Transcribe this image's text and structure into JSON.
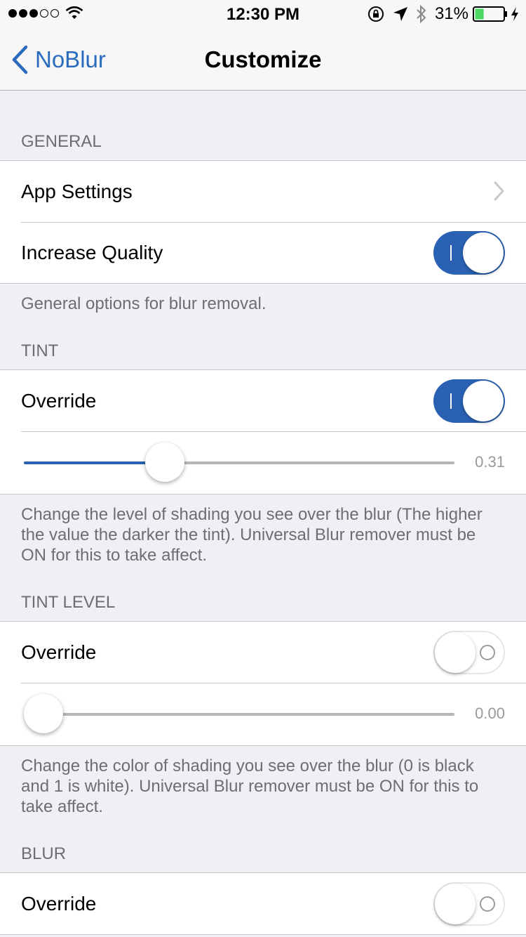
{
  "status_bar": {
    "time": "12:30 PM",
    "battery_percent": "31%",
    "battery_level": 0.31,
    "signal_bars_filled": 3,
    "signal_bars_total": 5
  },
  "nav": {
    "back_label": "NoBlur",
    "title": "Customize"
  },
  "sections": {
    "general": {
      "header": "GENERAL",
      "app_settings_label": "App Settings",
      "increase_quality_label": "Increase Quality",
      "increase_quality_on": true,
      "footer": "General options for blur removal."
    },
    "tint": {
      "header": "TINT",
      "override_label": "Override",
      "override_on": true,
      "slider_value": 0.31,
      "slider_value_text": "0.31",
      "footer": "Change the level of shading you see over the blur (The higher the value the darker the tint).  Universal Blur remover must be ON for this to take affect."
    },
    "tint_level": {
      "header": "TINT LEVEL",
      "override_label": "Override",
      "override_on": false,
      "slider_value": 0.0,
      "slider_value_text": "0.00",
      "footer": "Change the color of shading you see over the blur (0 is black and 1 is white).  Universal Blur remover must be ON for this to take affect."
    },
    "blur": {
      "header": "BLUR",
      "override_label": "Override",
      "override_on": false
    }
  },
  "colors": {
    "accent": "#2a6bbd",
    "toggle_on": "#2a61b2",
    "background": "#efeff4",
    "battery_fill": "#4cd964"
  },
  "icons": {
    "signal": "signal-dots-icon",
    "wifi": "wifi-icon",
    "rotation_lock": "rotation-lock-icon",
    "location": "location-arrow-icon",
    "bluetooth": "bluetooth-icon",
    "battery": "battery-icon",
    "charging": "charging-bolt-icon",
    "back": "chevron-left-icon",
    "disclosure": "chevron-right-icon"
  }
}
